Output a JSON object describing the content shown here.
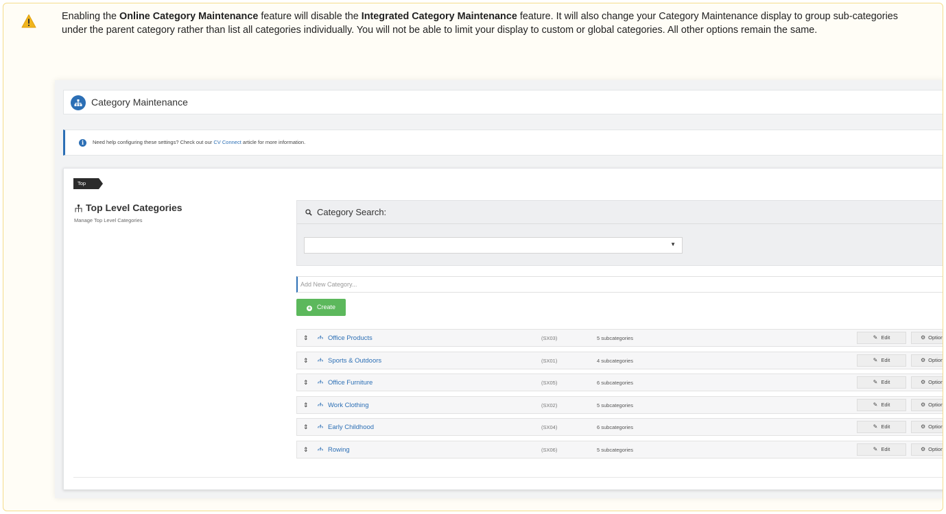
{
  "notice": {
    "p1": "Enabling the ",
    "b1": "Online Category Maintenance",
    "p2": " feature will disable the ",
    "b2": "Integrated Category Maintenance",
    "p3": " feature. It will also change your Category Maintenance display to group sub-categories under the parent category rather than list all categories individually. You will not be able to limit your display to custom or global categories. All other options remain the same."
  },
  "header": {
    "title": "Category Maintenance"
  },
  "help": {
    "text_before": "Need help configuring these settings? Check out our ",
    "link": "CV Connect",
    "text_after": " article for more information."
  },
  "breadcrumb": {
    "label": "Top"
  },
  "section": {
    "title": "Top Level Categories",
    "subtitle": "Manage Top Level Categories"
  },
  "search": {
    "title": "Category Search:",
    "selected": ""
  },
  "new_category": {
    "placeholder": "Add New Category...",
    "create_label": "Create"
  },
  "categories": [
    {
      "name": "Office Products",
      "code": "(SX03)",
      "subcategories": "5 subcategories"
    },
    {
      "name": "Sports & Outdoors",
      "code": "(SX01)",
      "subcategories": "4 subcategories"
    },
    {
      "name": "Office Furniture",
      "code": "(SX05)",
      "subcategories": "6 subcategories"
    },
    {
      "name": "Work Clothing",
      "code": "(SX02)",
      "subcategories": "5 subcategories"
    },
    {
      "name": "Early Childhood",
      "code": "(SX04)",
      "subcategories": "6 subcategories"
    },
    {
      "name": "Rowing",
      "code": "(SX06)",
      "subcategories": "5 subcategories"
    }
  ],
  "row_actions": {
    "edit": "Edit",
    "options": "Options"
  },
  "colors": {
    "warning_border": "#f5dc8b",
    "accent": "#2c6fb5",
    "create_green": "#5cb85c",
    "warning_icon": "#f0b51d"
  }
}
